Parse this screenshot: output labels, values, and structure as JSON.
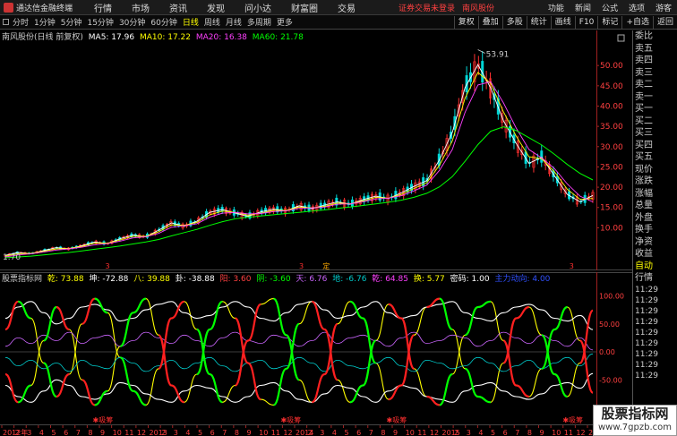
{
  "app": {
    "title": "通达信金融终端",
    "menus": [
      "行情",
      "市场",
      "资讯",
      "发现",
      "问小达",
      "财富圈",
      "交易"
    ],
    "alert": "证券交易未登录",
    "stock_name": "南风股份",
    "right_menus": [
      "功能",
      "新闻",
      "公式",
      "选项",
      "游客"
    ]
  },
  "toolbar": {
    "periods": [
      "分时",
      "1分钟",
      "5分钟",
      "15分钟",
      "30分钟",
      "60分钟",
      "日线",
      "周线",
      "月线",
      "多周期",
      "更多"
    ],
    "active_period": "日线",
    "tools": [
      "复权",
      "叠加",
      "多股",
      "统计",
      "画线",
      "F10",
      "标记",
      "+自选",
      "返回"
    ]
  },
  "price_legend": {
    "title": "南风股份(日线 前复权)",
    "ma5": "MA5: 17.96",
    "ma10": "MA10: 17.22",
    "ma20": "MA20: 16.38",
    "ma60": "MA60: 21.78"
  },
  "indicator_legend": {
    "name": "股票指标网",
    "v1": "乾: 73.88",
    "v2": "坤: -72.88",
    "v3": "八: 39.88",
    "v4": "卦: -38.88",
    "v5": "阳: 3.60",
    "v6": "阴: -3.60",
    "v7": "天: 6.76",
    "v8": "地: -6.76",
    "v9": "乾: 64.85",
    "v10": "换: 5.77",
    "v11": "密码: 1.00",
    "v12": "主力动向: 4.00"
  },
  "price_axis": [
    "50.00",
    "45.00",
    "40.00",
    "35.00",
    "30.00",
    "25.00",
    "20.00",
    "15.00",
    "10.00"
  ],
  "indicator_axis": [
    "100.00",
    "50.00",
    "0.00",
    "-50.00",
    "-100.00"
  ],
  "annotations": {
    "high": "53.91",
    "low": "1.70",
    "stage_marks": [
      "3",
      "3",
      "3"
    ],
    "mid_mark": "定",
    "buy_labels": [
      "✱吸筹",
      "✱吸筹",
      "✱吸筹",
      "✱吸筹"
    ]
  },
  "side_panel": {
    "items": [
      "委比",
      "卖五",
      "卖四",
      "卖三",
      "卖二",
      "卖一",
      "买一",
      "买二",
      "买三",
      "买四",
      "买五",
      "现价",
      "涨跌",
      "涨幅",
      "总量",
      "外盘",
      "换手",
      "净资",
      "收益"
    ],
    "auto_label": "自动",
    "quote_label": "行情",
    "times": [
      "11:29",
      "11:29",
      "11:29",
      "11:29",
      "11:29",
      "11:29",
      "11:29",
      "11:29",
      "11:29"
    ]
  },
  "dates": [
    "2012年",
    "2",
    "3",
    "4",
    "5",
    "6",
    "7",
    "8",
    "9",
    "10",
    "11",
    "12",
    "2013",
    "2",
    "3",
    "4",
    "5",
    "6",
    "7",
    "8",
    "9",
    "10",
    "11",
    "12",
    "2014",
    "2",
    "3",
    "4",
    "5",
    "6",
    "7",
    "8",
    "9",
    "10",
    "11",
    "12",
    "2015",
    "2",
    "3",
    "4",
    "5",
    "6",
    "7",
    "8",
    "9",
    "10",
    "11",
    "12",
    "2016"
  ],
  "watermark": {
    "title": "股票指标网",
    "url": "www.7gpzb.com"
  },
  "colors": {
    "candle_up": "#ff3030",
    "candle_down": "#00d8d8",
    "ma5": "#ffffff",
    "ma10": "#ffff00",
    "ma20": "#ff40ff",
    "ma60": "#00ff00",
    "price_axis": "#ff4040",
    "indicator_yellow": "#ffff00",
    "indicator_white": "#ffffff",
    "indicator_green": "#00ff00",
    "indicator_red": "#ff2020",
    "indicator_magenta": "#cc66ff",
    "indicator_cyan": "#00cccc"
  },
  "chart_data": [
    {
      "type": "line",
      "title": "南风股份(日线 前复权)",
      "ylim": [
        1.7,
        56
      ],
      "series": [
        {
          "name": "MA5",
          "values": [
            3.2,
            3.9,
            3.6,
            4.4,
            5.1,
            4.8,
            5.6,
            6.5,
            6.1,
            7.3,
            8.2,
            7.8,
            9.4,
            11.2,
            10.4,
            11.6,
            13.8,
            14.5,
            13.6,
            12.8,
            13.9,
            14.6,
            14.2,
            15.4,
            14.7,
            15.6,
            16.4,
            15.8,
            16.9,
            17.8,
            17.2,
            18.6,
            20.2,
            21.6,
            26.8,
            33.5,
            44.6,
            50.2,
            44.5,
            36.4,
            30.8,
            25.9,
            27.4,
            22.8,
            18.2,
            16.4,
            17.96
          ]
        },
        {
          "name": "MA10",
          "values": [
            3.0,
            3.6,
            3.7,
            4.2,
            4.8,
            4.9,
            5.4,
            6.2,
            6.2,
            7.0,
            7.9,
            7.9,
            9.0,
            10.7,
            10.6,
            11.3,
            13.2,
            14.1,
            13.8,
            13.1,
            13.6,
            14.3,
            14.3,
            15.1,
            14.9,
            15.3,
            16.1,
            15.9,
            16.6,
            17.5,
            17.3,
            18.2,
            19.7,
            21.1,
            25.5,
            31.4,
            42.0,
            48.3,
            45.6,
            38.6,
            32.6,
            27.5,
            27.0,
            23.8,
            19.5,
            17.0,
            17.22
          ]
        },
        {
          "name": "MA20",
          "values": [
            2.8,
            3.3,
            3.6,
            4.0,
            4.5,
            4.8,
            5.2,
            5.8,
            6.1,
            6.7,
            7.5,
            7.8,
            8.6,
            10.1,
            10.5,
            11.0,
            12.6,
            13.6,
            13.8,
            13.4,
            13.5,
            14.0,
            14.2,
            14.8,
            14.9,
            15.1,
            15.8,
            15.9,
            16.4,
            17.1,
            17.3,
            17.9,
            19.1,
            20.5,
            24.2,
            29.3,
            38.5,
            45.2,
            46.0,
            40.8,
            34.6,
            29.3,
            27.2,
            24.6,
            20.8,
            17.8,
            16.38
          ]
        },
        {
          "name": "MA60",
          "values": [
            2.6,
            2.8,
            3.0,
            3.3,
            3.6,
            3.9,
            4.3,
            4.7,
            5.1,
            5.5,
            6.0,
            6.5,
            7.1,
            8.0,
            8.8,
            9.6,
            10.6,
            11.5,
            12.2,
            12.6,
            12.9,
            13.2,
            13.5,
            13.8,
            14.1,
            14.4,
            14.8,
            15.1,
            15.5,
            15.9,
            16.3,
            16.8,
            17.5,
            18.5,
            20.1,
            22.6,
            26.4,
            30.5,
            33.8,
            34.9,
            34.0,
            32.2,
            30.4,
            28.1,
            25.6,
            23.4,
            21.78
          ]
        }
      ]
    },
    {
      "type": "line",
      "title": "股票指标网",
      "ylim": [
        -120,
        120
      ],
      "series": [
        {
          "name": "乾",
          "values": [
            40,
            90,
            60,
            -20,
            -80,
            -40,
            50,
            95,
            70,
            -10,
            -70,
            -95,
            -30,
            60,
            90,
            40,
            -40,
            -90,
            -60,
            20,
            85,
            95,
            30,
            -50,
            -90,
            -40,
            50,
            90,
            60,
            -20,
            -85,
            -60,
            30,
            80,
            95,
            40,
            -30,
            -80,
            -90,
            -20,
            60,
            80,
            30,
            -40,
            -80,
            -20,
            73.88
          ]
        },
        {
          "name": "坤",
          "values": [
            -40,
            -90,
            -60,
            20,
            80,
            40,
            -50,
            -95,
            -70,
            10,
            70,
            95,
            30,
            -60,
            -90,
            -40,
            40,
            90,
            60,
            -20,
            -85,
            -95,
            -30,
            50,
            90,
            40,
            -50,
            -90,
            -60,
            20,
            85,
            60,
            -30,
            -80,
            -95,
            -40,
            30,
            80,
            90,
            20,
            -60,
            -80,
            -30,
            40,
            80,
            20,
            -72.88
          ]
        },
        {
          "name": "八",
          "values": [
            60,
            80,
            90,
            70,
            50,
            60,
            80,
            85,
            75,
            55,
            60,
            75,
            85,
            90,
            70,
            60,
            65,
            80,
            90,
            80,
            60,
            55,
            70,
            85,
            90,
            75,
            60,
            65,
            80,
            90,
            70,
            60,
            65,
            80,
            85,
            90,
            70,
            60,
            55,
            70,
            80,
            85,
            75,
            60,
            55,
            65,
            39.88
          ]
        },
        {
          "name": "卦",
          "values": [
            -60,
            -80,
            -90,
            -70,
            -50,
            -60,
            -80,
            -85,
            -75,
            -55,
            -60,
            -75,
            -85,
            -90,
            -70,
            -60,
            -65,
            -80,
            -90,
            -80,
            -60,
            -55,
            -70,
            -85,
            -90,
            -75,
            -60,
            -65,
            -80,
            -90,
            -70,
            -60,
            -65,
            -80,
            -85,
            -90,
            -70,
            -60,
            -55,
            -70,
            -80,
            -85,
            -75,
            -60,
            -55,
            -65,
            -38.88
          ]
        },
        {
          "name": "阳",
          "values": [
            10,
            25,
            15,
            30,
            20,
            35,
            15,
            25,
            30,
            10,
            20,
            35,
            25,
            15,
            30,
            20,
            10,
            25,
            35,
            20,
            15,
            30,
            25,
            10,
            20,
            35,
            15,
            25,
            30,
            20,
            10,
            25,
            35,
            15,
            20,
            30,
            25,
            10,
            20,
            35,
            25,
            15,
            30,
            20,
            10,
            25,
            3.6
          ]
        },
        {
          "name": "阴",
          "values": [
            -10,
            -25,
            -15,
            -30,
            -20,
            -35,
            -15,
            -25,
            -30,
            -10,
            -20,
            -35,
            -25,
            -15,
            -30,
            -20,
            -10,
            -25,
            -35,
            -20,
            -15,
            -30,
            -25,
            -10,
            -20,
            -35,
            -15,
            -25,
            -30,
            -20,
            -10,
            -25,
            -35,
            -15,
            -20,
            -30,
            -25,
            -10,
            -20,
            -35,
            -25,
            -15,
            -30,
            -20,
            -10,
            -25,
            -3.6
          ]
        }
      ]
    }
  ]
}
